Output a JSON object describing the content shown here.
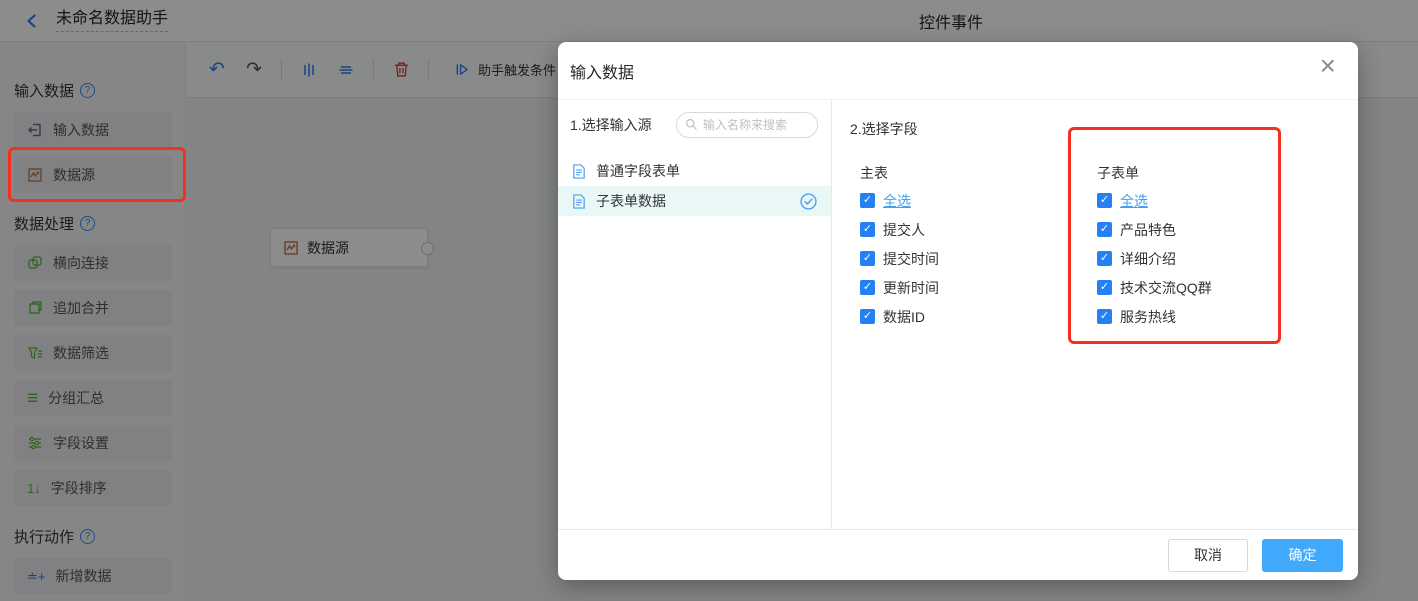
{
  "topbar": {
    "title": "未命名数据助手",
    "center_title": "控件事件"
  },
  "sidebar": {
    "sections": [
      {
        "label": "输入数据",
        "items": [
          {
            "label": "输入数据"
          },
          {
            "label": "数据源"
          }
        ]
      },
      {
        "label": "数据处理",
        "items": [
          {
            "label": "横向连接"
          },
          {
            "label": "追加合并"
          },
          {
            "label": "数据筛选"
          },
          {
            "label": "分组汇总"
          },
          {
            "label": "字段设置"
          },
          {
            "label": "字段排序"
          }
        ]
      },
      {
        "label": "执行动作",
        "items": [
          {
            "label": "新增数据"
          }
        ]
      }
    ]
  },
  "toolbar": {
    "trigger_label": "助手触发条件"
  },
  "canvas": {
    "node_label": "数据源"
  },
  "modal": {
    "title": "输入数据",
    "close_glyph": "×",
    "source_panel": {
      "step_label": "1.选择输入源",
      "search_placeholder": "输入名称来搜索",
      "items": [
        {
          "label": "普通字段表单",
          "selected": false
        },
        {
          "label": "子表单数据",
          "selected": true
        }
      ]
    },
    "fields_panel": {
      "step_label": "2.选择字段",
      "groups": [
        {
          "title": "主表",
          "options": [
            "全选",
            "提交人",
            "提交时间",
            "更新时间",
            "数据ID"
          ]
        },
        {
          "title": "子表单",
          "options": [
            "全选",
            "产品特色",
            "详细介绍",
            "技术交流QQ群",
            "服务热线"
          ]
        }
      ]
    },
    "footer": {
      "cancel": "取消",
      "confirm": "确定"
    }
  },
  "icons": {
    "checkbox_check": "✓",
    "undo": "↶",
    "redo": "↷",
    "group_lines": "≡",
    "sort": "1↓",
    "add": "≐+"
  },
  "colors": {
    "accent": "#2e8ef7",
    "link": "#40a0f8",
    "annotation": "#f5301e",
    "confirm": "#41a9fb",
    "checkbox": "#2580f4",
    "selectedBg": "#e9f7f6",
    "overlay": "rgba(0,0,0,0.45)"
  }
}
